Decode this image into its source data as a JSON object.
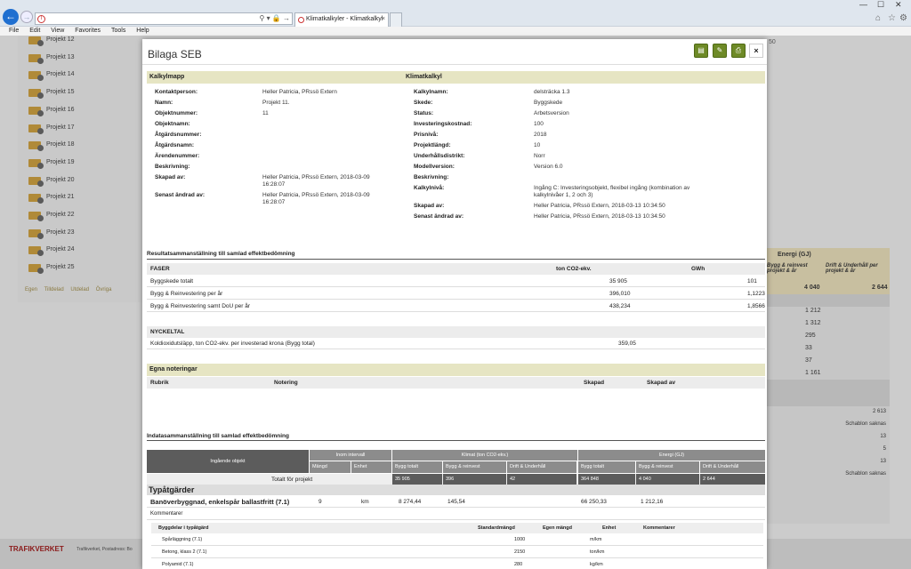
{
  "browser": {
    "back_icon": "back-arrow-icon",
    "tab_title": "Klimatkalkyler - Klimatkalkyl",
    "menu": [
      "File",
      "Edit",
      "View",
      "Favorites",
      "Tools",
      "Help"
    ]
  },
  "sidebar": {
    "projects": [
      "Projekt 12",
      "Projekt 13",
      "Projekt 14",
      "Projekt 15",
      "Projekt 16",
      "Projekt 17",
      "Projekt 18",
      "Projekt 19",
      "Projekt 20",
      "Projekt 21",
      "Projekt 22",
      "Projekt 23",
      "Projekt 24",
      "Projekt 25"
    ],
    "legend": [
      "Egen",
      "Tilldelad",
      "Utdelad",
      "Övriga"
    ]
  },
  "bg_top_right": "50",
  "right_panel": {
    "energy": "Energi (GJ)",
    "col1": "Bygg & reinvest projekt & år",
    "col2": "Drift & Underhåll per projekt & år",
    "v1": "4 040",
    "v2": "2 644",
    "list": [
      "1 212",
      "1 312",
      "295",
      "33",
      "37",
      "1 161"
    ],
    "list2": [
      "2 613",
      "Schablon saknas",
      "13",
      "5",
      "13",
      "Schablon saknas"
    ]
  },
  "footer": {
    "brand": "TRAFIKVERKET",
    "address": "Trafikverket, Postadress: Bo"
  },
  "modal": {
    "title": "Bilaga SEB",
    "btn_icons": [
      "document-icon",
      "edit-icon",
      "print-icon"
    ],
    "close": "×",
    "kalkylmapp": "Kalkylmapp",
    "klimatkalkyl": "Klimatkalkyl",
    "left_fields": [
      [
        "Kontaktperson:",
        "Heller Patricia, PRssö Extern"
      ],
      [
        "Namn:",
        "Projekt 11."
      ],
      [
        "Objektnummer:",
        "11"
      ],
      [
        "Objektnamn:",
        ""
      ],
      [
        "Åtgärdsnummer:",
        ""
      ],
      [
        "Åtgärdsnamn:",
        ""
      ],
      [
        "Ärendenummer:",
        ""
      ],
      [
        "Beskrivning:",
        ""
      ],
      [
        "Skapad av:",
        "Heller Patricia, PRssö Extern, 2018-03-09 16:28:07"
      ],
      [
        "Senast ändrad av:",
        "Heller Patricia, PRssö Extern, 2018-03-09 16:28:07"
      ]
    ],
    "right_fields": [
      [
        "Kalkylnamn:",
        "delsträcka 1.3"
      ],
      [
        "Skede:",
        "Byggskede"
      ],
      [
        "Status:",
        "Arbetsversion"
      ],
      [
        "Investeringskostnad:",
        "100"
      ],
      [
        "Prisnivå:",
        "2018"
      ],
      [
        "Projektlängd:",
        "10"
      ],
      [
        "Underhållsdistrikt:",
        "Norr"
      ],
      [
        "Modellversion:",
        "Version 6.0"
      ],
      [
        "Beskrivning:",
        ""
      ],
      [
        "Kalkylnivå:",
        "Ingång C: Investeringsobjekt, flexibel ingång (kombination av kalkylnivåer 1, 2 och 3)"
      ],
      [
        "Skapad av:",
        "Heller Patricia, PRssö Extern, 2018-03-13 10:34:50"
      ],
      [
        "Senast ändrad av:",
        "Heller Patricia, PRssö Extern, 2018-03-13 10:34:50"
      ]
    ],
    "result_title": "Resultatsammanställning till samlad effektbedömning",
    "faser": {
      "h": [
        "FASER",
        "ton CO2-ekv.",
        "GWh"
      ],
      "rows": [
        [
          "Byggskede totalt",
          "35 905",
          "101"
        ],
        [
          "Bygg & Reinvestering per år",
          "396,010",
          "1,1223"
        ],
        [
          "Bygg & Reinvestering samt DoU per år",
          "438,234",
          "1,8566"
        ]
      ]
    },
    "nyckeltal": {
      "h": "NYCKELTAL",
      "row": [
        "Koldioxidutsläpp, ton CO2-ekv. per investerad krona (Bygg total)",
        "359,05"
      ]
    },
    "egna": {
      "title": "Egna noteringar",
      "h": [
        "Rubrik",
        "Notering",
        "Skapad",
        "Skapad av"
      ]
    },
    "indata_title": "Indatasammanställning till samlad effektbedömning",
    "indata": {
      "ingaende": "Ingående objekt",
      "inom": "Inom intervall",
      "klimat": "Klimat (ton CO2-ekv.)",
      "energi": "Energi (GJ)",
      "sub": [
        "Mängd",
        "Enhet",
        "Bygg totalt",
        "Bygg & reinvest",
        "Drift & Underhåll",
        "Bygg totalt",
        "Bygg & reinvest",
        "Drift & Underhåll"
      ],
      "total": [
        "Totalt för projekt",
        "35 905",
        "396",
        "42",
        "364 848",
        "4 040",
        "2 644"
      ]
    },
    "typat": "Typåtgärder",
    "typ_row": [
      "Banöverbyggnad, enkelspår ballastfritt (7.1)",
      "9",
      "km",
      "8 274,44",
      "145,54",
      "66 250,33",
      "1 212,16"
    ],
    "kommentarer": "Kommentarer",
    "byggdel": {
      "h": [
        "Byggdelar i typåtgärd",
        "Standardmängd",
        "Egen mängd",
        "Enhet",
        "Kommentarer"
      ],
      "rows": [
        [
          "Spårläggning (7.1)",
          "1000",
          "",
          "m/km"
        ],
        [
          "Betong, klass 2 (7.1)",
          "2150",
          "",
          "ton/km"
        ],
        [
          "Polyamid (7.1)",
          "280",
          "",
          "kg/km"
        ]
      ]
    }
  }
}
